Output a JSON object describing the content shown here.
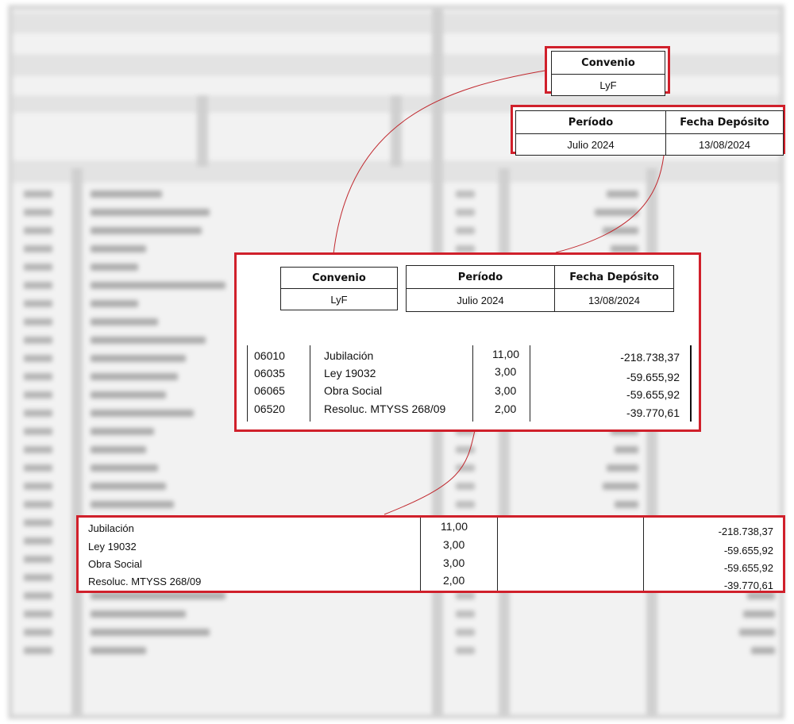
{
  "header": {
    "convenio_label": "Convenio",
    "convenio_value": "LyF",
    "periodo_label": "Período",
    "periodo_value": "Julio 2024",
    "fecha_label": "Fecha Depósito",
    "fecha_value": "13/08/2024"
  },
  "concepts": [
    {
      "code": "06010",
      "name": "Jubilación",
      "units": "11,00",
      "amount": "-218.738,37"
    },
    {
      "code": "06035",
      "name": "Ley 19032",
      "units": "3,00",
      "amount": "-59.655,92"
    },
    {
      "code": "06065",
      "name": "Obra Social",
      "units": "3,00",
      "amount": "-59.655,92"
    },
    {
      "code": "06520",
      "name": "Resoluc. MTYSS 268/09",
      "units": "2,00",
      "amount": "-39.770,61"
    }
  ],
  "colors": {
    "highlight": "#d0202b",
    "connector": "#c0282e",
    "blur_background": "#f2f2f2"
  }
}
